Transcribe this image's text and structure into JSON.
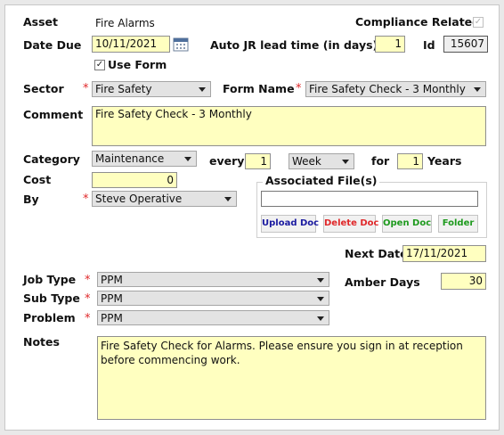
{
  "asset": {
    "label": "Asset",
    "value": "Fire Alarms"
  },
  "compliance": {
    "label": "Compliance Related",
    "checked": true
  },
  "date_due": {
    "label": "Date Due",
    "value": "10/11/2021"
  },
  "auto_jr": {
    "label": "Auto JR lead time (in days)",
    "value": "1"
  },
  "id_field": {
    "label": "Id",
    "value": "15607"
  },
  "use_form": {
    "label": "Use Form",
    "checked": true
  },
  "sector": {
    "label": "Sector",
    "value": "Fire Safety"
  },
  "form_name": {
    "label": "Form Name",
    "value": "Fire Safety Check - 3 Monthly"
  },
  "comment": {
    "label": "Comment",
    "value": "Fire Safety Check - 3 Monthly"
  },
  "category": {
    "label": "Category",
    "value": "Maintenance"
  },
  "every": {
    "label": "every",
    "value": "1"
  },
  "period": {
    "value": "Week"
  },
  "for_field": {
    "label": "for",
    "value": "1",
    "unit": "Years"
  },
  "cost": {
    "label": "Cost",
    "value": "0"
  },
  "by": {
    "label": "By",
    "value": "Steve Operative"
  },
  "files": {
    "title": "Associated File(s)",
    "input": "",
    "upload": "Upload Doc",
    "delete": "Delete Doc",
    "open": "Open Doc",
    "folder": "Folder",
    "upload_color": "#1a1aa0",
    "delete_color": "#e0282a",
    "open_color": "#1e9a1e",
    "folder_color": "#1e9a1e"
  },
  "next_date": {
    "label": "Next Date",
    "value": "17/11/2021"
  },
  "job_type": {
    "label": "Job Type",
    "value": "PPM"
  },
  "sub_type": {
    "label": "Sub Type",
    "value": "PPM"
  },
  "problem": {
    "label": "Problem",
    "value": "PPM"
  },
  "amber_days": {
    "label": "Amber Days",
    "value": "30"
  },
  "notes": {
    "label": "Notes",
    "value": "Fire Safety Check for Alarms. Please ensure you sign in at reception before commencing work."
  },
  "required_marker": "*",
  "check_mark": "✓",
  "icons": {
    "calendar": "calendar-icon",
    "dropdown": "chevron-down-icon"
  },
  "colors": {
    "field_bg": "#ffffc0",
    "select_bg": "#e3e3e3",
    "required": "#e0282a"
  }
}
